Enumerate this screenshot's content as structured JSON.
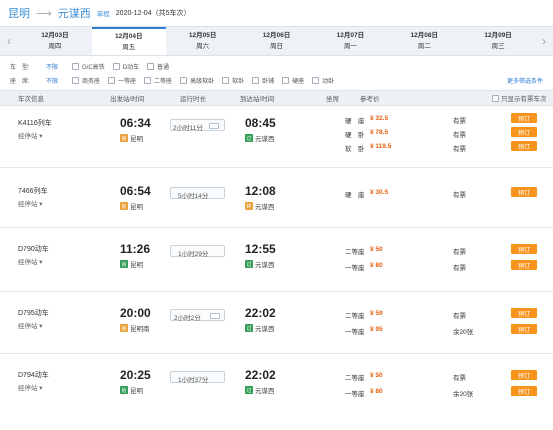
{
  "header": {
    "from": "昆明",
    "to": "元谋西",
    "trip_type": "单程",
    "date_info": "2020-12-04（共5车次）"
  },
  "dates": [
    {
      "d": "12月03日",
      "w": "周四"
    },
    {
      "d": "12月04日",
      "w": "周五"
    },
    {
      "d": "12月05日",
      "w": "周六"
    },
    {
      "d": "12月06日",
      "w": "周日"
    },
    {
      "d": "12月07日",
      "w": "周一"
    },
    {
      "d": "12月08日",
      "w": "周二"
    },
    {
      "d": "12月09日",
      "w": "周三"
    }
  ],
  "filters": {
    "type_label": "车　型:",
    "type_any": "不限",
    "types": [
      "G/C高铁",
      "D动车",
      "普通"
    ],
    "seat_label": "座　席:",
    "seat_any": "不限",
    "seats": [
      "商务座",
      "一等座",
      "二等座",
      "高级软卧",
      "软卧",
      "卧铺",
      "硬座",
      "动卧"
    ],
    "more": "更多筛选条件"
  },
  "table_head": {
    "train": "车次信息",
    "dep": "出发站/时间",
    "dur": "运行时长",
    "arr": "到达站/时间",
    "seat": "坐席",
    "price": "参考价",
    "only_avail": "只显示有票车次"
  },
  "trains": [
    {
      "no": "K4116列车",
      "stops": "经停站",
      "dep_time": "06:34",
      "dep_stn": "昆明",
      "dur": "2小时11分",
      "arr_time": "08:45",
      "arr_stn": "元谋西",
      "seats": [
        {
          "name": "硬　座",
          "price": "¥ 32.5",
          "avail": "有票",
          "btn": "预订"
        },
        {
          "name": "硬　卧",
          "price": "¥ 78.5",
          "avail": "有票",
          "btn": "预订"
        },
        {
          "name": "软　卧",
          "price": "¥ 119.5",
          "avail": "有票",
          "btn": "预订"
        }
      ]
    },
    {
      "no": "7466列车",
      "stops": "经停站",
      "dep_time": "06:54",
      "dep_stn": "昆明",
      "dur": "5小时14分",
      "arr_time": "12:08",
      "arr_stn": "元谋西",
      "seats": [
        {
          "name": "硬　座",
          "price": "¥ 30.5",
          "avail": "有票",
          "btn": "预订"
        }
      ]
    },
    {
      "no": "D790动车",
      "stops": "经停站",
      "dep_time": "11:26",
      "dep_stn": "昆明",
      "dur": "1小时29分",
      "arr_time": "12:55",
      "arr_stn": "元谋西",
      "seats": [
        {
          "name": "二等座",
          "price": "¥ 50",
          "avail": "有票",
          "btn": "预订"
        },
        {
          "name": "一等座",
          "price": "¥ 80",
          "avail": "有票",
          "btn": "预订"
        }
      ]
    },
    {
      "no": "D795动车",
      "stops": "经停站",
      "dep_time": "20:00",
      "dep_stn": "昆明南",
      "dur": "2小时2分",
      "arr_time": "22:02",
      "arr_stn": "元谋西",
      "seats": [
        {
          "name": "二等座",
          "price": "¥ 59",
          "avail": "有票",
          "btn": "预订"
        },
        {
          "name": "一等座",
          "price": "¥ 95",
          "avail": "余20张",
          "btn": "预订"
        }
      ]
    },
    {
      "no": "D794动车",
      "stops": "经停站",
      "dep_time": "20:25",
      "dep_stn": "昆明",
      "dur": "1小时37分",
      "arr_time": "22:02",
      "arr_stn": "元谋西",
      "seats": [
        {
          "name": "二等座",
          "price": "¥ 50",
          "avail": "有票",
          "btn": "预订"
        },
        {
          "name": "一等座",
          "price": "¥ 80",
          "avail": "余20张",
          "btn": "预订"
        }
      ]
    }
  ]
}
